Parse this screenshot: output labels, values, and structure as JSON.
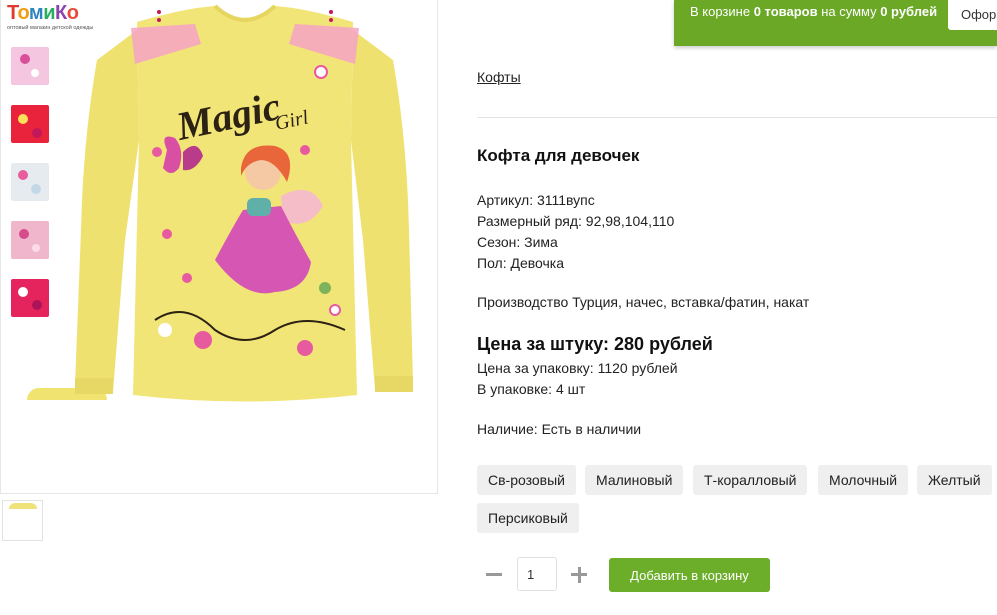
{
  "logo": {
    "name": "ТомиКо",
    "tagline": "оптовый магазин детской одежды"
  },
  "cart": {
    "prefix": "В корзине ",
    "count": "0 товаров",
    "middle": " на сумму ",
    "sum": "0 рублей",
    "checkout_label": "Оформить"
  },
  "breadcrumb": {
    "category": "Кофты"
  },
  "product": {
    "title": "Кофта для девочек",
    "specs": [
      "Артикул: 3111вупс",
      "Размерный ряд: 92,98,104,110",
      "Сезон: Зима",
      "Пол: Девочка"
    ],
    "description": "Производство Турция, начес, вставка/фатин, накат",
    "price_unit": "Цена за штуку: 280 рублей",
    "price_pack": "Цена за упаковку: 1120 рублей",
    "pack_count": "В упаковке: 4 шт",
    "availability": "Наличие: Есть в наличии",
    "shirt_print": {
      "word1": "Magic",
      "word2": "Girl"
    }
  },
  "colors": [
    "Св-розовый",
    "Малиновый",
    "Т-коралловый",
    "Молочный",
    "Желтый",
    "Персиковый"
  ],
  "quantity": {
    "value": "1"
  },
  "add_to_cart_label": "Добавить в корзину",
  "theme": {
    "accent": "#6aa826",
    "chip_bg": "#efefef",
    "shirt": "#f2e577"
  }
}
